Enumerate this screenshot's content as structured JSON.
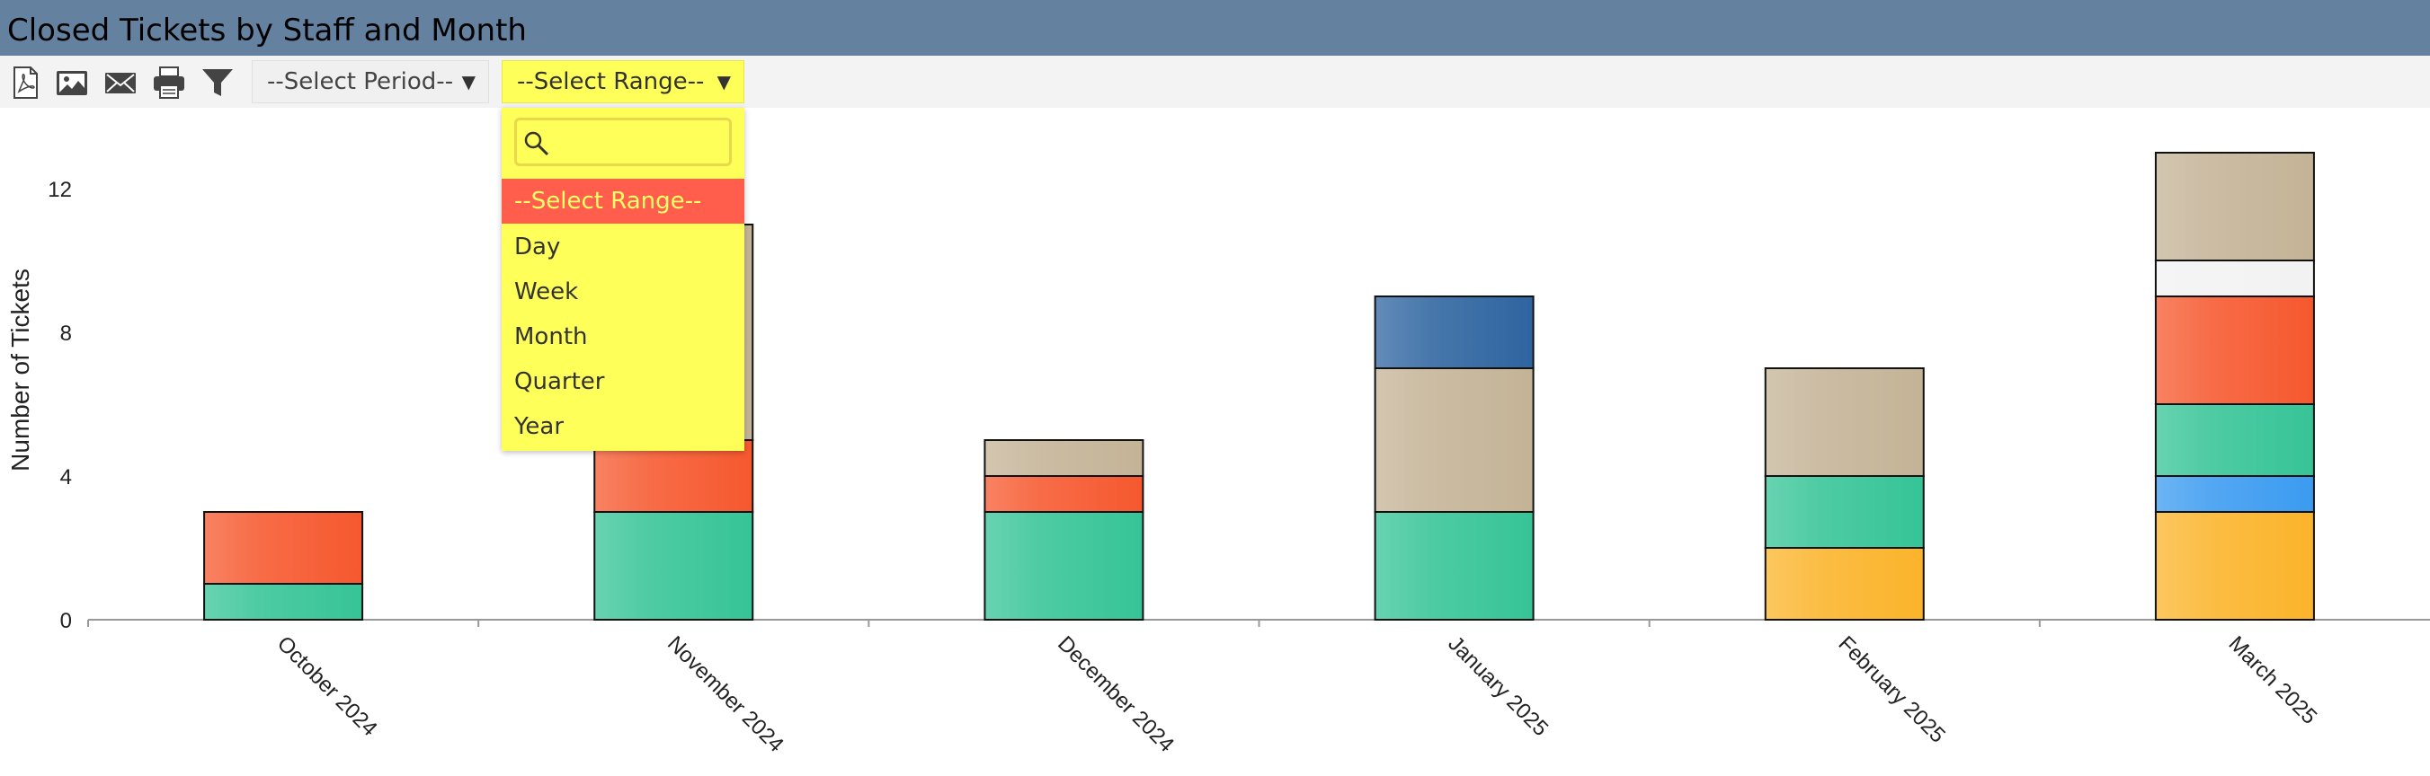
{
  "window": {
    "title": "Closed Tickets by Staff and Month"
  },
  "toolbar": {
    "icons": [
      "pdf-icon",
      "image-icon",
      "email-icon",
      "print-icon",
      "filter-icon"
    ],
    "period_select": {
      "value": "--Select Period--"
    },
    "range_select": {
      "value": "--Select Range--",
      "search_placeholder": "",
      "options": [
        "--Select Range--",
        "Day",
        "Week",
        "Month",
        "Quarter",
        "Year"
      ],
      "selected_index": 0
    }
  },
  "colors": {
    "title_bar": "#6482a0",
    "dropdown_bg": "#ffff5a",
    "dropdown_selected_bg": "#ff5e4c",
    "dropdown_selected_text": "#ffff6a"
  },
  "chart_data": {
    "type": "bar",
    "stacked": true,
    "title": "",
    "xlabel": "",
    "ylabel": "Number of Tickets",
    "ylim": [
      0,
      13.5
    ],
    "yticks": [
      0,
      4,
      8,
      12
    ],
    "grid": false,
    "categories": [
      "October 2024",
      "November 2024",
      "December 2024",
      "January 2025",
      "February 2025",
      "March 2025"
    ],
    "series": [
      {
        "color": "#fbb42a",
        "values": [
          0,
          0,
          0,
          0,
          2,
          3
        ]
      },
      {
        "color": "#3b9bf0",
        "values": [
          0,
          0,
          0,
          0,
          0,
          1
        ]
      },
      {
        "color": "#36c496",
        "values": [
          1,
          3,
          3,
          3,
          2,
          2
        ]
      },
      {
        "color": "#f6582e",
        "values": [
          2,
          2,
          1,
          0,
          0,
          3
        ]
      },
      {
        "color": "#f2f2f2",
        "values": [
          0,
          0,
          0,
          0,
          0,
          1
        ]
      },
      {
        "color": "#c4b396",
        "values": [
          0,
          6,
          1,
          4,
          3,
          3
        ]
      },
      {
        "color": "#2e64a0",
        "values": [
          0,
          0,
          0,
          2,
          0,
          0
        ]
      }
    ]
  }
}
